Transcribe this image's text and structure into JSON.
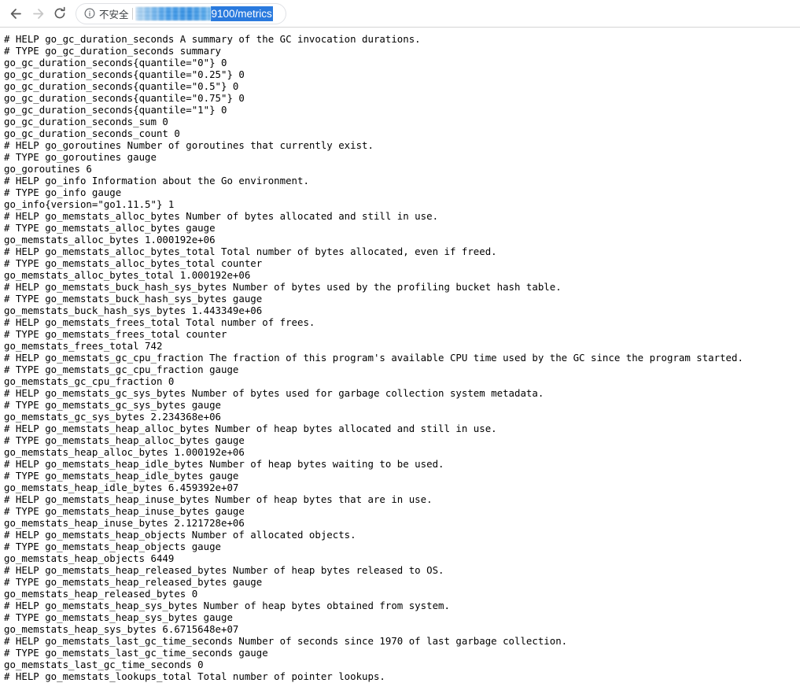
{
  "browser": {
    "back_label": "Back",
    "forward_label": "Forward",
    "reload_label": "Reload",
    "security_label": "不安全",
    "info_icon": "info-circle-icon",
    "url_redacted_placeholder": "",
    "url_selected_text": "9100/metrics",
    "selection_color": "#2a7ade",
    "selection_text_color": "#ffffff",
    "redaction_color": "#3f9aea"
  },
  "content": {
    "title": "metrics",
    "content_type": "text/plain",
    "text": "# HELP go_gc_duration_seconds A summary of the GC invocation durations.\n# TYPE go_gc_duration_seconds summary\ngo_gc_duration_seconds{quantile=\"0\"} 0\ngo_gc_duration_seconds{quantile=\"0.25\"} 0\ngo_gc_duration_seconds{quantile=\"0.5\"} 0\ngo_gc_duration_seconds{quantile=\"0.75\"} 0\ngo_gc_duration_seconds{quantile=\"1\"} 0\ngo_gc_duration_seconds_sum 0\ngo_gc_duration_seconds_count 0\n# HELP go_goroutines Number of goroutines that currently exist.\n# TYPE go_goroutines gauge\ngo_goroutines 6\n# HELP go_info Information about the Go environment.\n# TYPE go_info gauge\ngo_info{version=\"go1.11.5\"} 1\n# HELP go_memstats_alloc_bytes Number of bytes allocated and still in use.\n# TYPE go_memstats_alloc_bytes gauge\ngo_memstats_alloc_bytes 1.000192e+06\n# HELP go_memstats_alloc_bytes_total Total number of bytes allocated, even if freed.\n# TYPE go_memstats_alloc_bytes_total counter\ngo_memstats_alloc_bytes_total 1.000192e+06\n# HELP go_memstats_buck_hash_sys_bytes Number of bytes used by the profiling bucket hash table.\n# TYPE go_memstats_buck_hash_sys_bytes gauge\ngo_memstats_buck_hash_sys_bytes 1.443349e+06\n# HELP go_memstats_frees_total Total number of frees.\n# TYPE go_memstats_frees_total counter\ngo_memstats_frees_total 742\n# HELP go_memstats_gc_cpu_fraction The fraction of this program's available CPU time used by the GC since the program started.\n# TYPE go_memstats_gc_cpu_fraction gauge\ngo_memstats_gc_cpu_fraction 0\n# HELP go_memstats_gc_sys_bytes Number of bytes used for garbage collection system metadata.\n# TYPE go_memstats_gc_sys_bytes gauge\ngo_memstats_gc_sys_bytes 2.234368e+06\n# HELP go_memstats_heap_alloc_bytes Number of heap bytes allocated and still in use.\n# TYPE go_memstats_heap_alloc_bytes gauge\ngo_memstats_heap_alloc_bytes 1.000192e+06\n# HELP go_memstats_heap_idle_bytes Number of heap bytes waiting to be used.\n# TYPE go_memstats_heap_idle_bytes gauge\ngo_memstats_heap_idle_bytes 6.459392e+07\n# HELP go_memstats_heap_inuse_bytes Number of heap bytes that are in use.\n# TYPE go_memstats_heap_inuse_bytes gauge\ngo_memstats_heap_inuse_bytes 2.121728e+06\n# HELP go_memstats_heap_objects Number of allocated objects.\n# TYPE go_memstats_heap_objects gauge\ngo_memstats_heap_objects 6449\n# HELP go_memstats_heap_released_bytes Number of heap bytes released to OS.\n# TYPE go_memstats_heap_released_bytes gauge\ngo_memstats_heap_released_bytes 0\n# HELP go_memstats_heap_sys_bytes Number of heap bytes obtained from system.\n# TYPE go_memstats_heap_sys_bytes gauge\ngo_memstats_heap_sys_bytes 6.6715648e+07\n# HELP go_memstats_last_gc_time_seconds Number of seconds since 1970 of last garbage collection.\n# TYPE go_memstats_last_gc_time_seconds gauge\ngo_memstats_last_gc_time_seconds 0\n# HELP go_memstats_lookups_total Total number of pointer lookups."
  }
}
